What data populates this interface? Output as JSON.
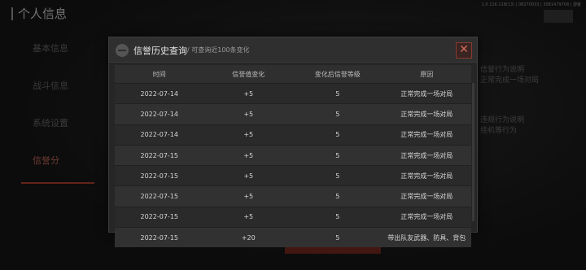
{
  "background": {
    "title": "个人信息",
    "version": "1.0.116.118(13) | 08270033 | 3081479708 | 游客",
    "side_items": [
      "基本信息",
      "战斗信息",
      "系统设置",
      "信誉分"
    ],
    "right_texts": [
      "信誉行为说明",
      "正常完成一场对局",
      "违规行为说明",
      "挂机等行为"
    ],
    "bottom_button": "信誉值历史查询"
  },
  "modal": {
    "title": "信誉历史查询",
    "subtitle": "/ 可查询近100条变化",
    "close_label": "✕",
    "columns": [
      "时间",
      "信誉值变化",
      "变化后信誉等级",
      "原因"
    ],
    "rows": [
      [
        "2022-07-14",
        "+5",
        "5",
        "正常完成一场对局"
      ],
      [
        "2022-07-14",
        "+5",
        "5",
        "正常完成一场对局"
      ],
      [
        "2022-07-14",
        "+5",
        "5",
        "正常完成一场对局"
      ],
      [
        "2022-07-15",
        "+5",
        "5",
        "正常完成一场对局"
      ],
      [
        "2022-07-15",
        "+5",
        "5",
        "正常完成一场对局"
      ],
      [
        "2022-07-15",
        "+5",
        "5",
        "正常完成一场对局"
      ],
      [
        "2022-07-15",
        "+5",
        "5",
        "正常完成一场对局"
      ],
      [
        "2022-07-15",
        "+20",
        "5",
        "带出队友武器、防具、背包"
      ]
    ]
  },
  "colors": {
    "accent": "#b3412e",
    "panel": "#262626"
  }
}
